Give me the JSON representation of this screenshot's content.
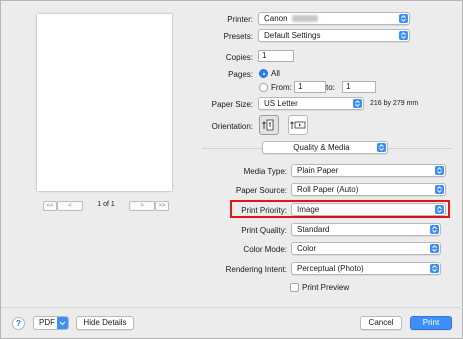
{
  "pager": {
    "first_label": "<<",
    "prev_label": "<",
    "page_text": "1 of 1",
    "next_label": ">",
    "last_label": ">>"
  },
  "printer": {
    "label": "Printer:",
    "value": "Canon"
  },
  "presets": {
    "label": "Presets:",
    "value": "Default Settings"
  },
  "copies": {
    "label": "Copies:",
    "value": "1"
  },
  "pages": {
    "label": "Pages:",
    "all_label": "All",
    "from_label": "From:",
    "from_value": "1",
    "to_label": "to:",
    "to_value": "1"
  },
  "paper_size": {
    "label": "Paper Size:",
    "value": "US Letter",
    "dimensions": "216 by 279 mm"
  },
  "orientation": {
    "label": "Orientation:",
    "portrait_icon": "portrait-orientation-icon",
    "landscape_icon": "landscape-orientation-icon"
  },
  "section": {
    "value": "Quality & Media"
  },
  "media_type": {
    "label": "Media Type:",
    "value": "Plain Paper"
  },
  "paper_source": {
    "label": "Paper Source:",
    "value": "Roll Paper (Auto)"
  },
  "print_priority": {
    "label": "Print Priority:",
    "value": "Image"
  },
  "print_quality": {
    "label": "Print Quality:",
    "value": "Standard"
  },
  "color_mode": {
    "label": "Color Mode:",
    "value": "Color"
  },
  "rendering_intent": {
    "label": "Rendering Intent:",
    "value": "Perceptual (Photo)"
  },
  "print_preview": {
    "label": "Print Preview",
    "checked": false
  },
  "footer": {
    "help_label": "?",
    "pdf_label": "PDF",
    "hide_details_label": "Hide Details",
    "cancel_label": "Cancel",
    "print_label": "Print"
  },
  "colors": {
    "accent": "#3d8ff7",
    "highlight": "#e0141e",
    "background": "#ececec"
  }
}
